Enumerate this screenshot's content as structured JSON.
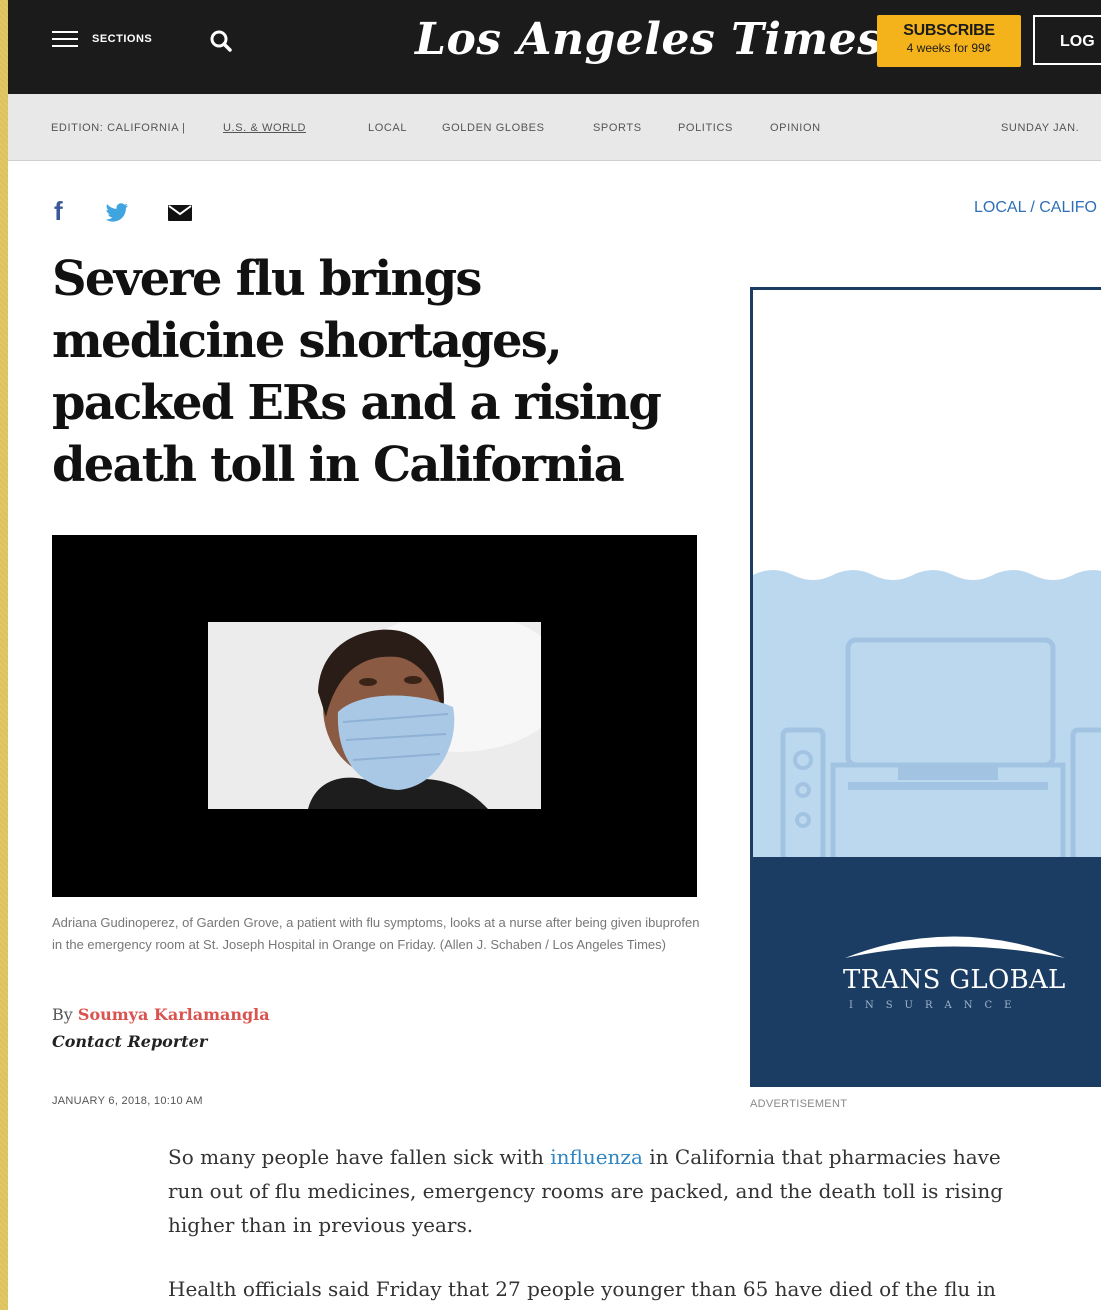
{
  "header": {
    "sections_label": "SECTIONS",
    "logo": "Los Angeles Times",
    "subscribe_label": "SUBSCRIBE",
    "subscribe_offer": "4 weeks for 99¢",
    "login_label": "LOG",
    "colors": {
      "bar": "#1b1b1b",
      "subscribe": "#f5b31b"
    }
  },
  "subnav": {
    "edition": "EDITION: CALIFORNIA |",
    "edition_link": "U.S. & WORLD",
    "items": [
      "LOCAL",
      "GOLDEN GLOBES",
      "SPORTS",
      "POLITICS",
      "OPINION"
    ],
    "date": "SUNDAY JAN."
  },
  "article": {
    "breadcrumb": "LOCAL / CALIFO",
    "headline": "Severe flu brings medicine shortages, packed ERs and a rising death toll in California",
    "caption": "Adriana Gudinoperez, of Garden Grove, a patient with flu symptoms, looks at a nurse after being given ibuprofen in the emergency room at St. Joseph Hospital in Orange on Friday. (Allen J. Schaben / Los Angeles Times)",
    "byline_prefix": "By",
    "author": "Soumya Karlamangla",
    "contact": "Contact Reporter",
    "timestamp": "JANUARY 6, 2018, 10:10 AM",
    "p1_before": "So many people have fallen sick with ",
    "p1_link": "influenza",
    "p1_after": " in California that pharmacies have run out of flu medicines, emergency rooms are packed, and the death toll is rising higher than in previous years.",
    "p2": "Health officials said Friday that 27 people younger than 65 have died of the flu in"
  },
  "ad": {
    "brand": "TRANS GLOBAL",
    "tagline": "INSURANCE",
    "label": "ADVERTISEMENT"
  },
  "icons": [
    "menu-icon",
    "search-icon",
    "facebook-icon",
    "twitter-icon",
    "email-icon"
  ]
}
